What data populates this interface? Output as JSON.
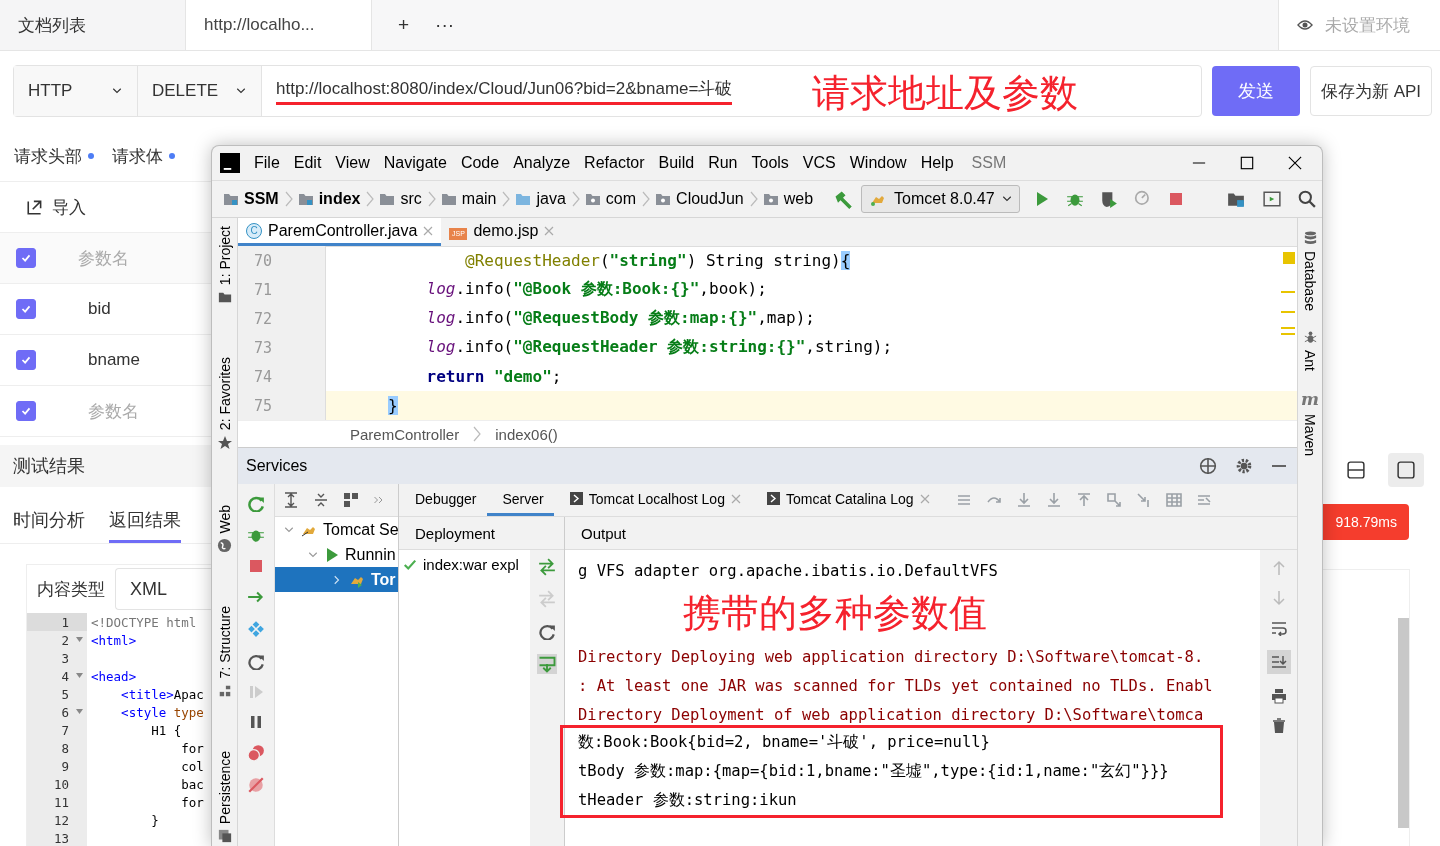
{
  "tabs": [
    {
      "label": "文档列表",
      "selected": false
    },
    {
      "label": "http://localho...",
      "selected": true
    }
  ],
  "tab_actions": [
    "+",
    "···"
  ],
  "environment": "未设置环境",
  "request": {
    "protocol": "HTTP",
    "method": "DELETE",
    "url": "http://localhost:8080/index/Cloud/Jun06?bid=2&bname=斗破",
    "url_underlined": true,
    "annotation": "请求地址及参数",
    "send": "发送",
    "save": "保存为新 API"
  },
  "request_tabs": [
    {
      "label": "请求头部",
      "has_content": true
    },
    {
      "label": "请求体",
      "has_content": true
    }
  ],
  "import": "导入",
  "params": {
    "header": {
      "label": "参数名",
      "checked": true
    },
    "rows": [
      {
        "name": "bid",
        "checked": true
      },
      {
        "name": "bname",
        "checked": true
      }
    ],
    "new_row": {
      "placeholder": "参数名",
      "checked": true
    }
  },
  "results": {
    "title": "测试结果",
    "tabs": [
      {
        "label": "时间分析",
        "selected": false
      },
      {
        "label": "返回结果",
        "selected": true
      }
    ],
    "layouts": [
      {
        "kind": "split",
        "selected": false
      },
      {
        "kind": "single",
        "selected": true
      }
    ],
    "time": "918.79ms",
    "content_type_label": "内容类型",
    "content_type": "XML",
    "code": [
      {
        "num": "1",
        "fold": false,
        "current": true,
        "parts": [
          {
            "kind": "doctype",
            "text": "<!DOCTYPE html"
          }
        ]
      },
      {
        "num": "2",
        "fold": true,
        "current": false,
        "parts": [
          {
            "kind": "tag",
            "text": "<html>"
          }
        ]
      },
      {
        "num": "3",
        "fold": false,
        "current": false
      },
      {
        "num": "4",
        "fold": true,
        "current": false,
        "parts": [
          {
            "kind": "tag",
            "text": "<head>"
          }
        ]
      },
      {
        "num": "5",
        "fold": false,
        "current": false,
        "parts": [
          {
            "kind": "tag",
            "text": "    <title>"
          },
          {
            "kind": "plain",
            "text": "Apac"
          }
        ]
      },
      {
        "num": "6",
        "fold": true,
        "current": false,
        "parts": [
          {
            "kind": "tag",
            "text": "    <style "
          },
          {
            "kind": "attr",
            "text": "type"
          }
        ]
      },
      {
        "num": "7",
        "fold": false,
        "current": false,
        "parts": [
          {
            "kind": "plain",
            "text": "        H1 {"
          }
        ]
      },
      {
        "num": "8",
        "fold": false,
        "current": false,
        "parts": [
          {
            "kind": "plain",
            "text": "            for"
          }
        ]
      },
      {
        "num": "9",
        "fold": false,
        "current": false,
        "parts": [
          {
            "kind": "plain",
            "text": "            col"
          }
        ]
      },
      {
        "num": "10",
        "fold": false,
        "current": false,
        "parts": [
          {
            "kind": "plain",
            "text": "            bac"
          }
        ]
      },
      {
        "num": "11",
        "fold": false,
        "current": false,
        "parts": [
          {
            "kind": "plain",
            "text": "            for"
          }
        ]
      },
      {
        "num": "12",
        "fold": false,
        "current": false,
        "parts": [
          {
            "kind": "plain",
            "text": "        }"
          }
        ]
      },
      {
        "num": "13",
        "fold": false,
        "current": false
      }
    ]
  },
  "ide": {
    "menu": [
      "File",
      "Edit",
      "View",
      "Navigate",
      "Code",
      "Analyze",
      "Refactor",
      "Build",
      "Run",
      "Tools",
      "VCS",
      "Window",
      "Help"
    ],
    "project": "SSM",
    "breadcrumbs": [
      {
        "label": "SSM",
        "kind": "project"
      },
      {
        "label": "index",
        "kind": "module"
      },
      {
        "label": "src",
        "kind": "folder"
      },
      {
        "label": "main",
        "kind": "folder"
      },
      {
        "label": "java",
        "kind": "source"
      },
      {
        "label": "com",
        "kind": "package"
      },
      {
        "label": "CloudJun",
        "kind": "package"
      },
      {
        "label": "web",
        "kind": "package"
      }
    ],
    "run_config": "Tomcet 8.0.47",
    "left_tools": [
      {
        "label": "1: Project",
        "kind": "folder"
      },
      {
        "label": "2: Favorites",
        "kind": "star"
      },
      {
        "label": "Web",
        "kind": "globe"
      },
      {
        "label": "7: Structure",
        "kind": "structure"
      },
      {
        "label": "Persistence",
        "kind": "persistence"
      }
    ],
    "right_tools": [
      {
        "label": "Database",
        "kind": "database"
      },
      {
        "label": "Ant",
        "kind": "ant"
      },
      {
        "label": "Maven",
        "kind": "maven",
        "glyph": "m"
      }
    ],
    "editor_tabs": [
      {
        "label": "ParemController.java",
        "kind": "class",
        "badge": "C",
        "selected": true
      },
      {
        "label": "demo.jsp",
        "kind": "jsp",
        "badge": "JSP",
        "selected": false
      }
    ],
    "code": [
      {
        "num": "70",
        "current": false,
        "parts": [
          {
            "kind": "annotation",
            "text": "        @RequestHeader"
          },
          {
            "kind": "plain",
            "text": "("
          },
          {
            "kind": "string",
            "text": "\"string\""
          },
          {
            "kind": "plain",
            "text": ") String string)"
          },
          {
            "kind": "match",
            "text": "{"
          }
        ]
      },
      {
        "num": "71",
        "current": false,
        "parts": [
          {
            "kind": "field",
            "text": "    log"
          },
          {
            "kind": "plain",
            "text": ".info("
          },
          {
            "kind": "string",
            "text": "\"@Book 参数:Book:{}\""
          },
          {
            "kind": "plain",
            "text": ",book);"
          }
        ]
      },
      {
        "num": "72",
        "current": false,
        "parts": [
          {
            "kind": "field",
            "text": "    log"
          },
          {
            "kind": "plain",
            "text": ".info("
          },
          {
            "kind": "string",
            "text": "\"@RequestBody 参数:map:{}\""
          },
          {
            "kind": "plain",
            "text": ",map);"
          }
        ]
      },
      {
        "num": "73",
        "current": false,
        "parts": [
          {
            "kind": "field",
            "text": "    log"
          },
          {
            "kind": "plain",
            "text": ".info("
          },
          {
            "kind": "string",
            "text": "\"@RequestHeader 参数:string:{}\""
          },
          {
            "kind": "plain",
            "text": ",string);"
          }
        ]
      },
      {
        "num": "74",
        "current": false,
        "parts": [
          {
            "kind": "keyword",
            "text": "    return"
          },
          {
            "kind": "string",
            "text": " \"demo\""
          },
          {
            "kind": "plain",
            "text": ";"
          }
        ]
      },
      {
        "num": "75",
        "current": true,
        "parts": [
          {
            "kind": "match",
            "text": "}"
          }
        ]
      }
    ],
    "breadcrumb": [
      "ParemController",
      "index06()"
    ],
    "services": {
      "title": "Services",
      "tree": [
        {
          "label": "Tomcat Se",
          "kind": "server",
          "expanded": true,
          "selected": false,
          "children": [
            {
              "label": "Runnin",
              "kind": "running",
              "expanded": true,
              "selected": false,
              "children": [
                {
                  "label": "Tor",
                  "kind": "instance",
                  "expanded": false,
                  "selected": true
                }
              ]
            }
          ]
        }
      ],
      "tabs": [
        {
          "label": "Debugger",
          "selected": false,
          "closable": false
        },
        {
          "label": "Server",
          "selected": true,
          "closable": false
        },
        {
          "label": "Tomcat Localhost Log",
          "selected": false,
          "closable": true
        },
        {
          "label": "Tomcat Catalina Log",
          "selected": false,
          "closable": true
        }
      ],
      "deployment": {
        "title": "Deployment",
        "items": [
          {
            "label": "index:war expl",
            "deployed": true
          }
        ]
      },
      "output": {
        "title": "Output",
        "lines": [
          {
            "kind": "info",
            "framed": false,
            "text": "g VFS adapter org.apache.ibatis.io.DefaultVFS"
          },
          {
            "kind": "annotation",
            "framed": false,
            "text": "携带的多种参数值"
          },
          {
            "kind": "warn",
            "framed": false,
            "text": "Directory Deploying web application directory D:\\Software\\tomcat-8."
          },
          {
            "kind": "warn",
            "framed": false,
            "text": ": At least one JAR was scanned for TLDs yet contained no TLDs. Enabl"
          },
          {
            "kind": "warn",
            "framed": false,
            "text": "Directory Deployment of web application directory D:\\Software\\tomca"
          },
          {
            "kind": "info",
            "framed": true,
            "text": "数:Book:Book{bid=2, bname='斗破', price=null}"
          },
          {
            "kind": "info",
            "framed": true,
            "text": "tBody 参数:map:{map={bid:1,bname:\"圣墟\",type:{id:1,name:\"玄幻\"}}}"
          },
          {
            "kind": "info",
            "framed": true,
            "text": "tHeader 参数:string:ikun"
          }
        ]
      }
    }
  }
}
